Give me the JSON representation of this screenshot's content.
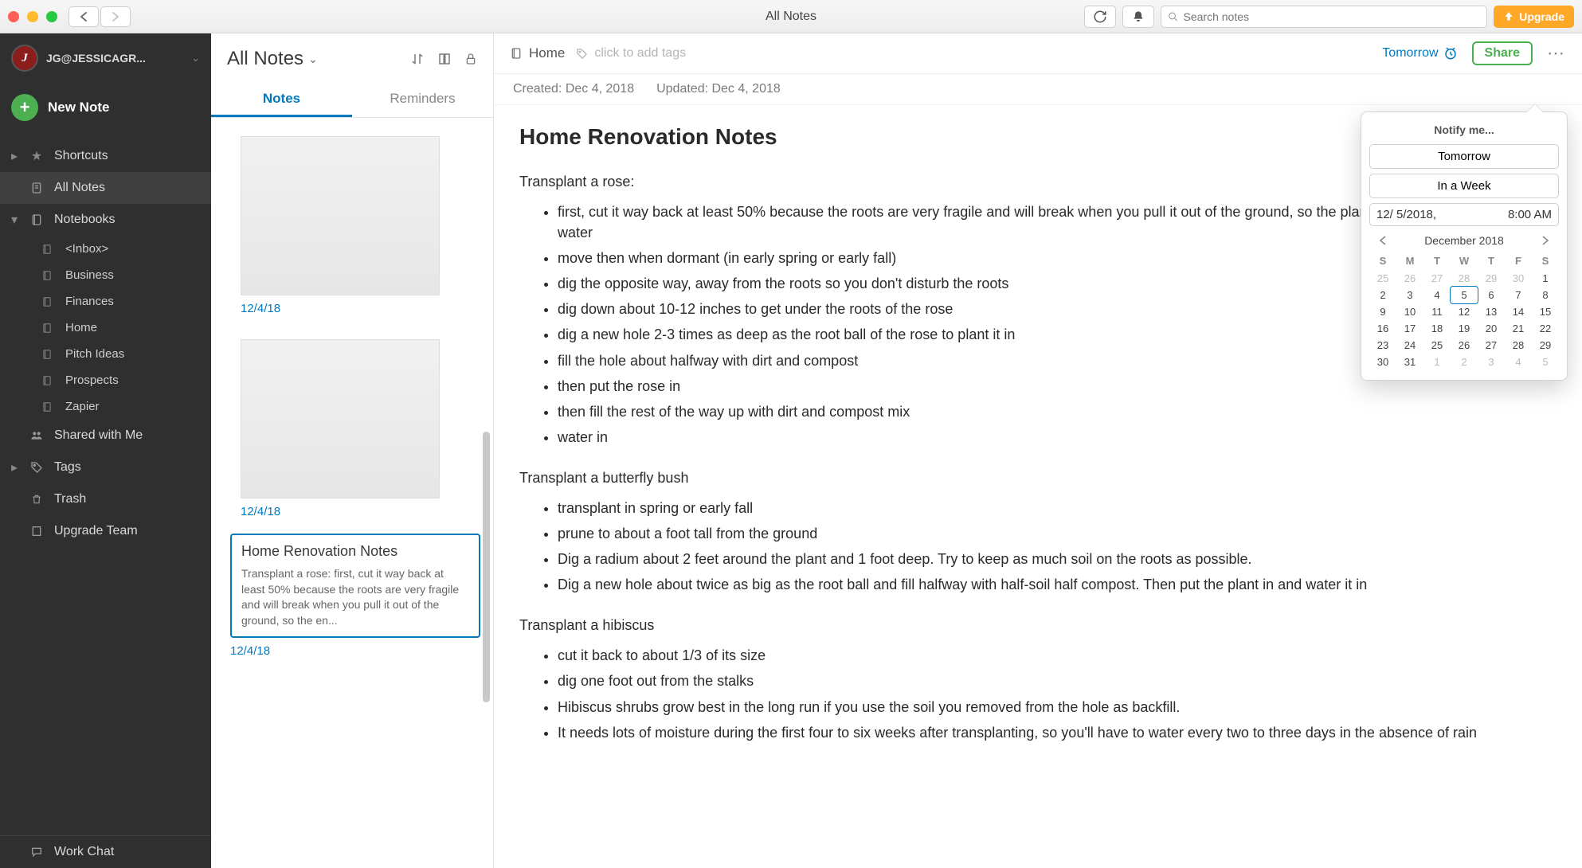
{
  "window": {
    "title": "All Notes"
  },
  "titlebar": {
    "search_placeholder": "Search notes",
    "upgrade_label": "Upgrade"
  },
  "sidebar": {
    "account_name": "JG@JESSICAGR...",
    "avatar_letter": "J",
    "new_note_label": "New Note",
    "items": {
      "shortcuts": "Shortcuts",
      "all_notes": "All Notes",
      "notebooks": "Notebooks",
      "shared": "Shared with Me",
      "tags": "Tags",
      "trash": "Trash",
      "upgrade_team": "Upgrade Team"
    },
    "notebooks": [
      "<Inbox>",
      "Business",
      "Finances",
      "Home",
      "Pitch Ideas",
      "Prospects",
      "Zapier"
    ],
    "work_chat": "Work Chat"
  },
  "notelist": {
    "title": "All Notes",
    "tabs": {
      "notes": "Notes",
      "reminders": "Reminders"
    },
    "cards": [
      {
        "type": "thumb",
        "date": "12/4/18"
      },
      {
        "type": "thumb",
        "date": "12/4/18"
      },
      {
        "type": "text",
        "title": "Home Renovation Notes",
        "snippet": "Transplant a rose: first, cut it way back at least 50% because the roots are very fragile and will break when you pull it out of the ground, so the en...",
        "date": "12/4/18",
        "selected": true
      }
    ]
  },
  "editor": {
    "notebook": "Home",
    "tag_placeholder": "click to add tags",
    "reminder_label": "Tomorrow",
    "share_label": "Share",
    "created_label": "Created: Dec 4, 2018",
    "updated_label": "Updated: Dec 4, 2018",
    "title": "Home Renovation Notes",
    "sections": [
      {
        "heading": "Transplant a rose:",
        "items": [
          "first, cut it way back at least 50% because the roots are very fragile and will break when you pull it out of the ground, so the plant won't be able to get enough water",
          "move then when dormant (in early spring or early fall)",
          "dig the opposite way, away from the roots so you don't disturb the roots",
          "dig down about 10-12 inches to get under the roots of the rose",
          "dig a new hole 2-3 times as deep as the root ball of the rose to plant it in",
          "fill the hole about halfway with dirt and compost",
          "then put the rose in",
          "then fill the rest of the way up with dirt and compost mix",
          "water in"
        ]
      },
      {
        "heading": "Transplant a butterfly bush",
        "items": [
          "transplant in spring or early fall",
          "prune to about a foot tall from the ground",
          "Dig a radium about 2 feet around the plant and 1 foot deep. Try to keep as much soil on the roots as possible.",
          "Dig a new hole about twice as big as the root ball and fill halfway with half-soil half compost. Then put the plant in and water it in"
        ]
      },
      {
        "heading": "Transplant a hibiscus",
        "items": [
          "cut it back to about 1/3 of its size",
          "dig one foot out from the stalks",
          "Hibiscus shrubs grow best in the long run if you use the soil you removed from the hole as backfill.",
          "It needs lots of moisture during the first four to six weeks after transplanting, so you'll have to water every two to three days in the absence of rain"
        ]
      }
    ]
  },
  "reminder_popover": {
    "title": "Notify me...",
    "quick": {
      "tomorrow": "Tomorrow",
      "week": "In a Week"
    },
    "date": "12/ 5/2018,",
    "time": "8:00 AM",
    "calendar": {
      "month_label": "December 2018",
      "dow": [
        "S",
        "M",
        "T",
        "W",
        "T",
        "F",
        "S"
      ],
      "weeks": [
        [
          {
            "d": 25,
            "o": true
          },
          {
            "d": 26,
            "o": true
          },
          {
            "d": 27,
            "o": true
          },
          {
            "d": 28,
            "o": true
          },
          {
            "d": 29,
            "o": true
          },
          {
            "d": 30,
            "o": true
          },
          {
            "d": 1
          }
        ],
        [
          {
            "d": 2
          },
          {
            "d": 3
          },
          {
            "d": 4
          },
          {
            "d": 5,
            "hover": true
          },
          {
            "d": 6
          },
          {
            "d": 7
          },
          {
            "d": 8
          }
        ],
        [
          {
            "d": 9
          },
          {
            "d": 10
          },
          {
            "d": 11
          },
          {
            "d": 12
          },
          {
            "d": 13
          },
          {
            "d": 14
          },
          {
            "d": 15
          }
        ],
        [
          {
            "d": 16
          },
          {
            "d": 17
          },
          {
            "d": 18
          },
          {
            "d": 19
          },
          {
            "d": 20
          },
          {
            "d": 21
          },
          {
            "d": 22
          }
        ],
        [
          {
            "d": 23
          },
          {
            "d": 24
          },
          {
            "d": 25
          },
          {
            "d": 26
          },
          {
            "d": 27
          },
          {
            "d": 28
          },
          {
            "d": 29
          }
        ],
        [
          {
            "d": 30
          },
          {
            "d": 31
          },
          {
            "d": 1,
            "o": true
          },
          {
            "d": 2,
            "o": true
          },
          {
            "d": 3,
            "o": true
          },
          {
            "d": 4,
            "o": true
          },
          {
            "d": 5,
            "o": true
          }
        ]
      ]
    }
  }
}
